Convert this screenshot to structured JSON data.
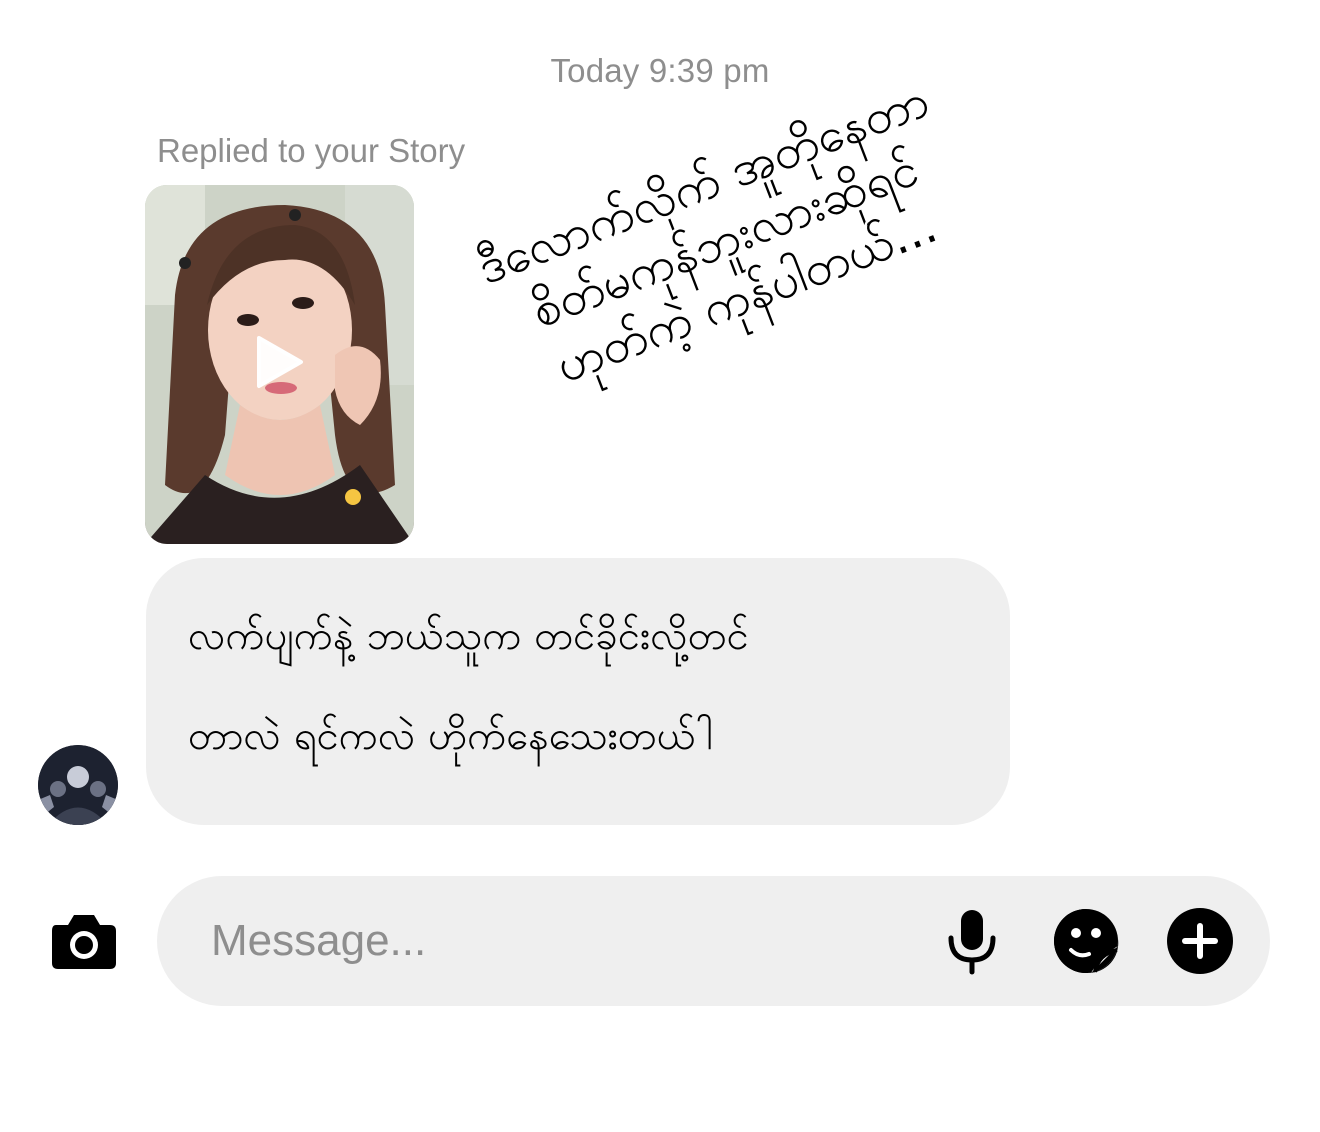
{
  "thread": {
    "timestamp": "Today 9:39 pm",
    "replied_label": "Replied to your Story"
  },
  "story": {
    "media_icon": "play-icon"
  },
  "overlay_caption": {
    "lines": [
      "ဒီလောက်လိုက် အူတိုနေတာ",
      "စိတ်မကုန်ဘူးလားဆိုရင်",
      "ဟုတ်ကဲ့ ကုန်ပါတယ်..."
    ]
  },
  "message": {
    "lines": [
      "လက်ပျက်နဲ့ ဘယ်သူက တင်ခိုင်းလို့တင်",
      "တာလဲ ရင်ကလဲ ဟိုက်နေသေးတယ်ါ"
    ],
    "bubble_color": "#efefef"
  },
  "composer": {
    "placeholder": "Message...",
    "icons": [
      "camera-icon",
      "microphone-icon",
      "sticker-icon",
      "plus-icon"
    ]
  }
}
